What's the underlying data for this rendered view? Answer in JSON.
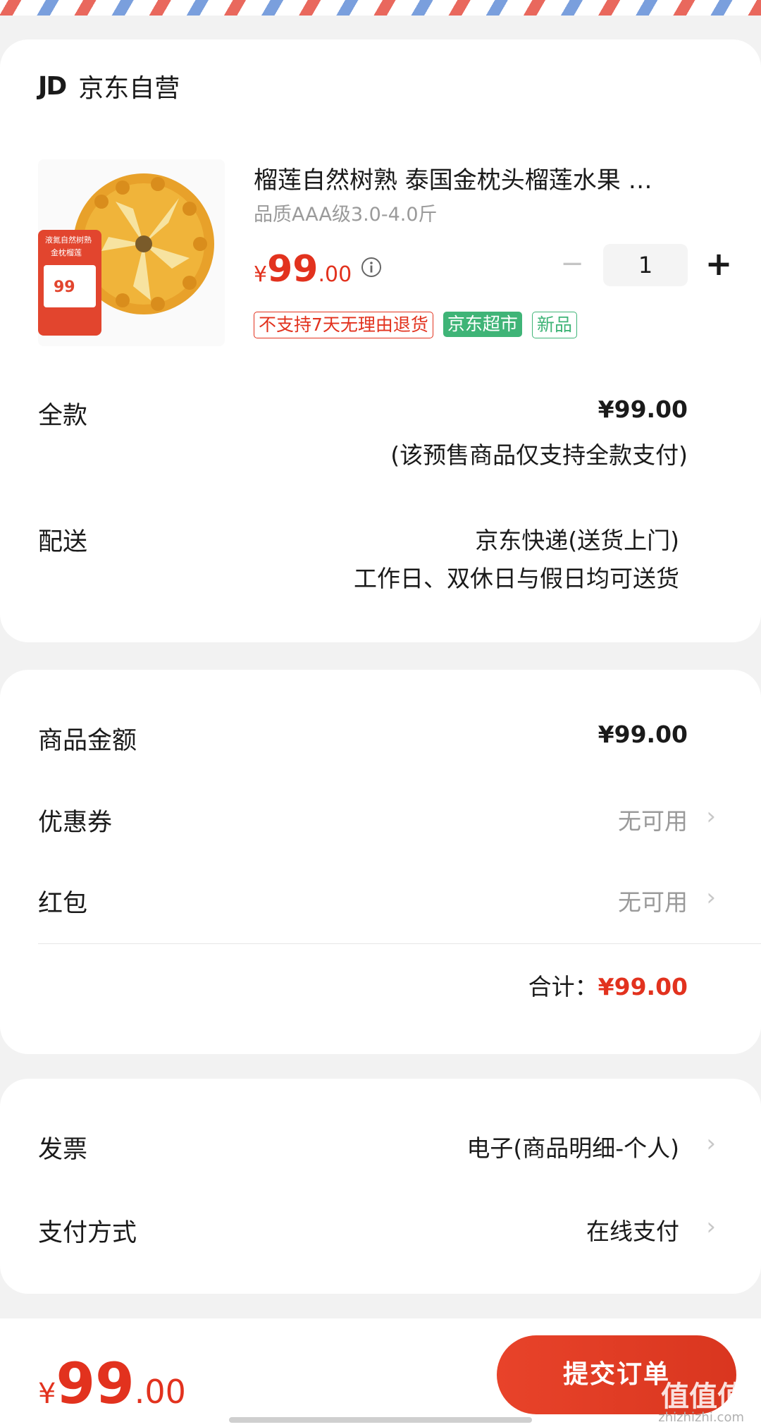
{
  "shop": {
    "logo": "JD",
    "name": "京东自营"
  },
  "product": {
    "title": "榴莲自然树熟 泰国金枕头榴莲水果 …",
    "spec": "品质AAA级3.0-4.0斤",
    "price_yen": "¥",
    "price_int": "99",
    "price_dec": ".00",
    "quantity": "1",
    "image_badge_lines": [
      "液氮自然树熟",
      "金枕榴莲"
    ],
    "image_badge_price": "99",
    "tags": [
      "不支持7天无理由退货",
      "京东超市",
      "新品"
    ]
  },
  "payment": {
    "label": "全款",
    "value": "¥99.00",
    "note": "(该预售商品仅支持全款支付)"
  },
  "delivery": {
    "label": "配送",
    "method": "京东快递(送货上门)",
    "schedule": "工作日、双休日与假日均可送货"
  },
  "summary": {
    "goods_label": "商品金额",
    "goods_value": "¥99.00",
    "coupon_label": "优惠券",
    "coupon_value": "无可用",
    "redpacket_label": "红包",
    "redpacket_value": "无可用",
    "total_label": "合计：",
    "total_value": "¥99.00"
  },
  "invoice": {
    "label": "发票",
    "value": "电子(商品明细-个人)"
  },
  "paymethod": {
    "label": "支付方式",
    "value": "在线支付"
  },
  "bottom": {
    "price_yen": "¥",
    "price_int": "99",
    "price_dec": ".00",
    "submit_label": "提交订单",
    "watermark": "值值值",
    "watermark_sub": "zhizhizhi.com"
  },
  "colors": {
    "accent": "#e2321e",
    "green": "#3fb477"
  }
}
